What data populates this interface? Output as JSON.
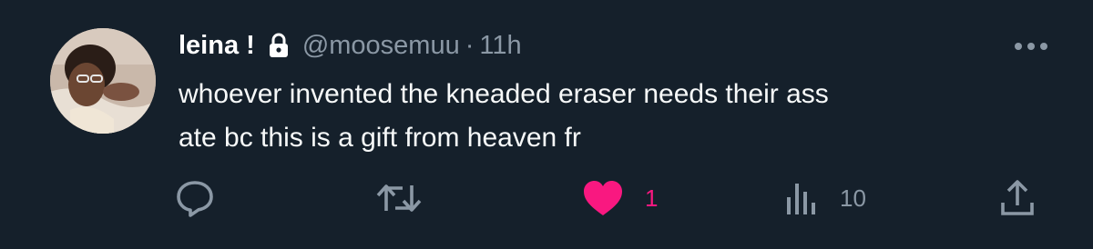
{
  "tweet": {
    "display_name": "leina !",
    "handle": "@moosemuu",
    "separator": "·",
    "time": "11h",
    "text_line1": "whoever invented the kneaded eraser needs their ass",
    "text_line2": "ate bc this is a gift from heaven fr",
    "badge_icon": "lock-icon",
    "actions": {
      "reply": {
        "icon": "reply-icon"
      },
      "retweet": {
        "icon": "retweet-icon"
      },
      "like": {
        "icon": "heart-icon",
        "count": "1",
        "active": true,
        "color": "#f91880"
      },
      "views": {
        "icon": "analytics-icon",
        "count": "10"
      },
      "share": {
        "icon": "share-icon"
      }
    }
  },
  "colors": {
    "background": "#15202b",
    "primary_text": "#f7f9f9",
    "secondary_text": "#8b98a5",
    "like": "#f91880"
  }
}
